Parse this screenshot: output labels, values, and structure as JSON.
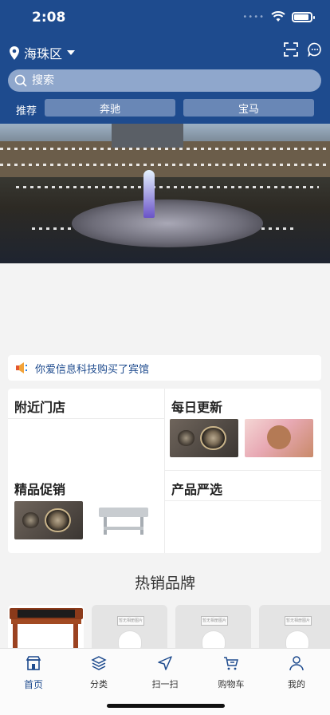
{
  "status_bar": {
    "time": "2:08"
  },
  "header": {
    "location": "海珠区",
    "search_placeholder": "搜索",
    "recommend_label": "推荐",
    "recommend_chips": [
      "奔驰",
      "宝马"
    ]
  },
  "notice": {
    "text": "你爱信息科技购买了宾馆"
  },
  "grid": {
    "cells": [
      {
        "title": "附近门店"
      },
      {
        "title": "每日更新"
      },
      {
        "title": "精品促销"
      },
      {
        "title": "产品严选"
      }
    ]
  },
  "hot_brands": {
    "title": "热销品牌",
    "placeholder_text": "暂无相册图片"
  },
  "tabbar": {
    "items": [
      {
        "label": "首页",
        "icon": "home-icon",
        "active": true
      },
      {
        "label": "分类",
        "icon": "layers-icon",
        "active": false
      },
      {
        "label": "扫一扫",
        "icon": "send-icon",
        "active": false
      },
      {
        "label": "购物车",
        "icon": "cart-icon",
        "active": false
      },
      {
        "label": "我的",
        "icon": "user-icon",
        "active": false
      }
    ]
  },
  "colors": {
    "primary": "#1e4b8e",
    "search_bg": "#8fa7cc",
    "chip_bg": "#6987b6",
    "page_bg": "#f3f3f3"
  }
}
